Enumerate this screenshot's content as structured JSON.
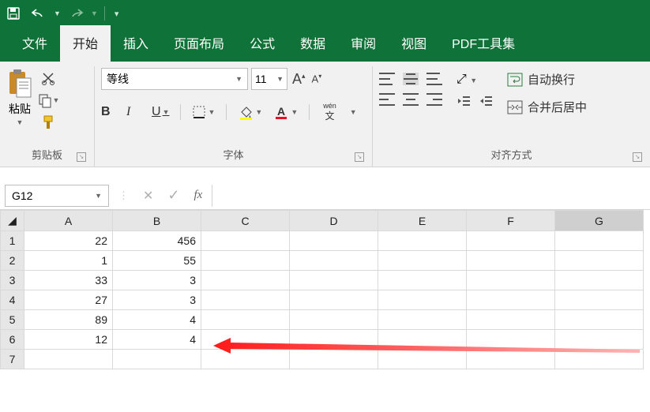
{
  "titlebar": {
    "save": "save-icon",
    "undo": "undo-icon",
    "redo": "redo-icon"
  },
  "tabs": [
    "文件",
    "开始",
    "插入",
    "页面布局",
    "公式",
    "数据",
    "审阅",
    "视图",
    "PDF工具集"
  ],
  "active_tab": "开始",
  "ribbon": {
    "clipboard": {
      "label": "剪贴板",
      "paste": "粘贴"
    },
    "font": {
      "label": "字体",
      "name": "等线",
      "size": "11",
      "bold": "B",
      "italic": "I",
      "underline": "U",
      "wen_top": "wén",
      "wen_bottom": "文"
    },
    "align": {
      "label": "对齐方式",
      "wrap": "自动换行",
      "merge": "合并后居中"
    }
  },
  "namebox": "G12",
  "fx": "fx",
  "columns": [
    "A",
    "B",
    "C",
    "D",
    "E",
    "F",
    "G"
  ],
  "rows": [
    {
      "n": "1",
      "A": "22",
      "B": "456"
    },
    {
      "n": "2",
      "A": "1",
      "B": "55"
    },
    {
      "n": "3",
      "A": "33",
      "B": "3"
    },
    {
      "n": "4",
      "A": "27",
      "B": "3"
    },
    {
      "n": "5",
      "A": "89",
      "B": "4"
    },
    {
      "n": "6",
      "A": "12",
      "B": "4"
    },
    {
      "n": "7",
      "A": "",
      "B": ""
    }
  ]
}
